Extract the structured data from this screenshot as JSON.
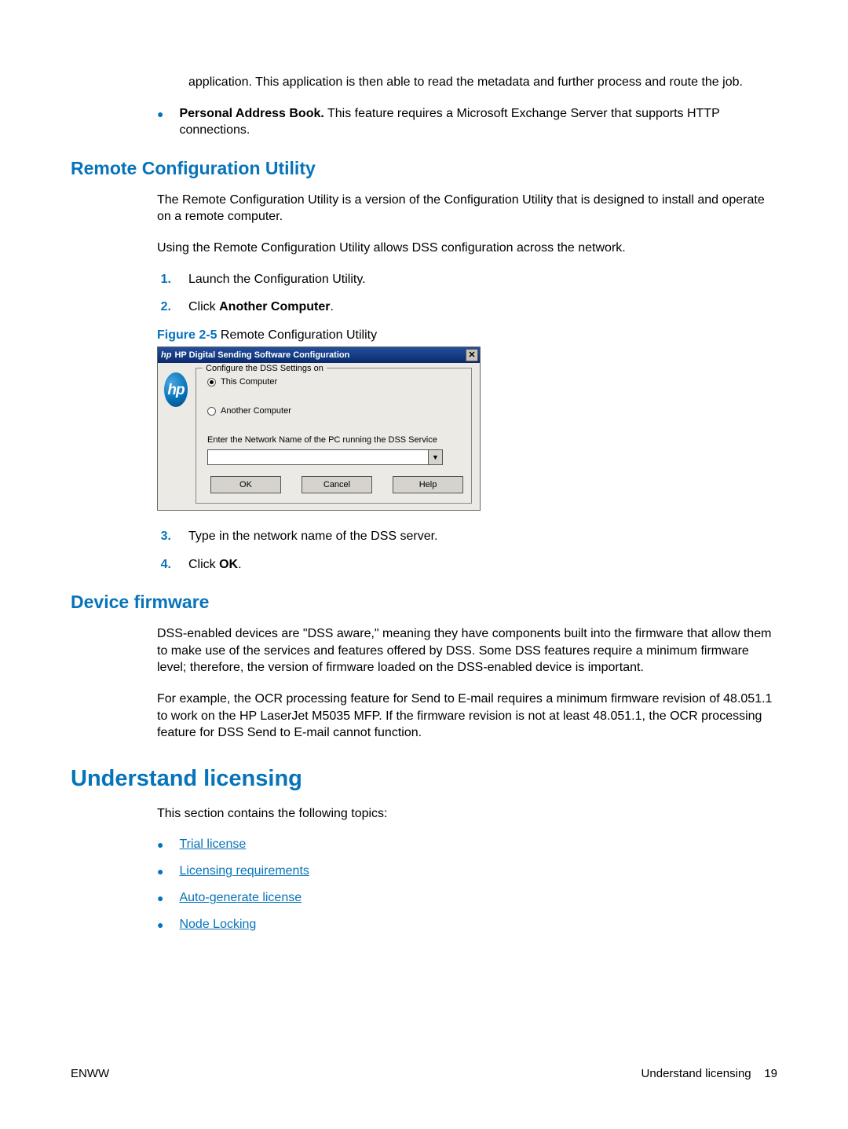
{
  "intro": {
    "p1": "application. This application is then able to read the metadata and further process and route the job."
  },
  "bullet_pab": {
    "lead": "Personal Address Book.",
    "rest": " This feature requires a Microsoft Exchange Server that supports HTTP connections."
  },
  "rcu": {
    "heading": "Remote Configuration Utility",
    "p1": "The Remote Configuration Utility is a version of the Configuration Utility that is designed to install and operate on a remote computer.",
    "p2": "Using the Remote Configuration Utility allows DSS configuration across the network.",
    "step1": "Launch the Configuration Utility.",
    "step2_pre": "Click ",
    "step2_bold": "Another Computer",
    "step2_post": ".",
    "fig_label_strong": "Figure 2-5",
    "fig_label_rest": "  Remote Configuration Utility",
    "step3": "Type in the network name of the DSS server.",
    "step4_pre": "Click ",
    "step4_bold": "OK",
    "step4_post": ".",
    "numbers": {
      "n1": "1.",
      "n2": "2.",
      "n3": "3.",
      "n4": "4."
    }
  },
  "dialog": {
    "title": "HP Digital Sending Software Configuration",
    "logo_text": "hp",
    "legend": "Configure the DSS Settings on",
    "radio_this": "This Computer",
    "radio_another": "Another Computer",
    "net_label": "Enter the Network Name of the PC running the DSS Service",
    "ok": "OK",
    "cancel": "Cancel",
    "help": "Help"
  },
  "firmware": {
    "heading": "Device firmware",
    "p1": "DSS-enabled devices are \"DSS aware,\" meaning they have components built into the firmware that allow them to make use of the services and features offered by DSS. Some DSS features require a minimum firmware level; therefore, the version of firmware loaded on the DSS-enabled device is important.",
    "p2": "For example, the OCR processing feature for Send to E-mail requires a minimum firmware revision of 48.051.1 to work on the HP LaserJet M5035 MFP. If the firmware revision is not at least 48.051.1, the OCR processing feature for DSS Send to E-mail cannot function."
  },
  "licensing": {
    "heading": "Understand licensing",
    "intro": "This section contains the following topics:",
    "links": {
      "trial": "Trial license",
      "req": "Licensing requirements",
      "auto": "Auto-generate license",
      "node": "Node Locking"
    }
  },
  "footer": {
    "left": "ENWW",
    "right_label": "Understand licensing",
    "right_page": "19"
  }
}
